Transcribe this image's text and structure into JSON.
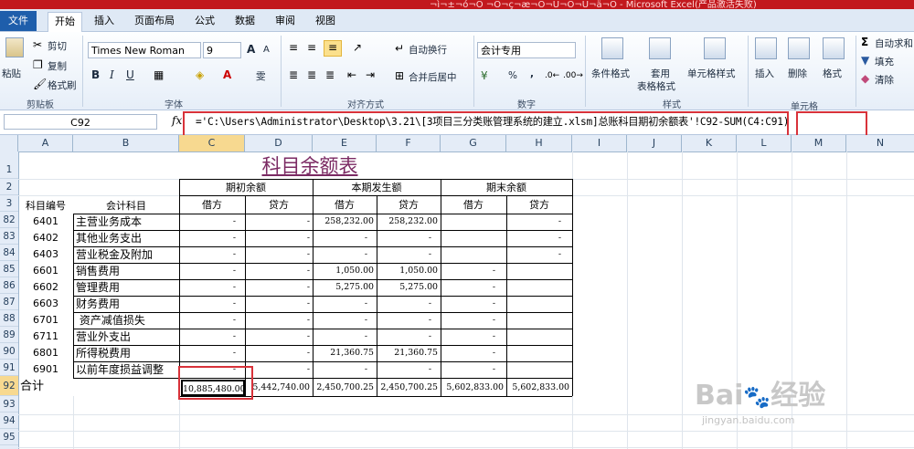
{
  "window": {
    "title": "¬ì¬±¬ó¬Ô ¬Ó¬ç¬æ¬Ö¬Ü¬Ö¬Ú¬ä¬Ö - Microsoft Excel(产品激活失败)"
  },
  "tabs": [
    "文件",
    "开始",
    "插入",
    "页面布局",
    "公式",
    "数据",
    "审阅",
    "视图"
  ],
  "ribbon": {
    "clipboard": {
      "paste": "粘贴",
      "cut": "剪切",
      "copy": "复制",
      "format_painter": "格式刷",
      "group": "剪贴板"
    },
    "font": {
      "name": "Times New Roman",
      "size": "9",
      "group": "字体",
      "bold": "B",
      "italic": "I",
      "underline": "U",
      "grow": "A",
      "shrink": "A",
      "wen": "雯"
    },
    "alignment": {
      "wrap": "自动换行",
      "merge": "合并后居中",
      "group": "对齐方式"
    },
    "number": {
      "format": "会计专用",
      "group": "数字",
      "percent": "%",
      "comma": ","
    },
    "styles": {
      "conditional": "条件格式",
      "table_1": "套用",
      "table_2": "表格格式",
      "cell_style": "单元格样式",
      "group": "样式"
    },
    "cells": {
      "insert": "插入",
      "delete": "删除",
      "format": "格式",
      "group": "单元格"
    },
    "editing": {
      "autosum": "自动求和",
      "fill": "填充",
      "clear": "清除"
    }
  },
  "formula_bar": {
    "name_box": "C92",
    "fx": "fx",
    "formula_part1": "='C:\\Users\\Administrator\\Desktop\\3.21\\[3项目三分类账管理系统的建立.xlsm]总账科目期初余额表'!C92",
    "formula_part2": "-SUM(C4:C91)"
  },
  "columns": [
    "A",
    "B",
    "C",
    "D",
    "E",
    "F",
    "G",
    "H",
    "I",
    "J",
    "K",
    "L",
    "M",
    "N"
  ],
  "row_labels": [
    "1",
    "2",
    "3",
    "82",
    "83",
    "84",
    "85",
    "86",
    "87",
    "88",
    "89",
    "90",
    "91",
    "92",
    "93",
    "94",
    "95"
  ],
  "sheet": {
    "title": "科目余额表",
    "header_code": "科目编号",
    "header_account": "会计科目",
    "group_opening": "期初余额",
    "group_current": "本期发生额",
    "group_closing": "期末余额",
    "debit": "借方",
    "credit": "贷方",
    "rows": [
      {
        "code": "6401",
        "name": "主营业务成本",
        "c": "-",
        "d": "-",
        "e": "258,232.00",
        "f": "258,232.00",
        "g": "",
        "h": "-"
      },
      {
        "code": "6402",
        "name": "其他业务支出",
        "c": "-",
        "d": "-",
        "e": "-",
        "f": "-",
        "g": "",
        "h": "-"
      },
      {
        "code": "6403",
        "name": "营业税金及附加",
        "c": "-",
        "d": "-",
        "e": "-",
        "f": "-",
        "g": "",
        "h": "-"
      },
      {
        "code": "6601",
        "name": "销售费用",
        "c": "-",
        "d": "-",
        "e": "1,050.00",
        "f": "1,050.00",
        "g": "-",
        "h": ""
      },
      {
        "code": "6602",
        "name": "管理费用",
        "c": "-",
        "d": "-",
        "e": "5,275.00",
        "f": "5,275.00",
        "g": "-",
        "h": ""
      },
      {
        "code": "6603",
        "name": "财务费用",
        "c": "-",
        "d": "-",
        "e": "-",
        "f": "-",
        "g": "-",
        "h": ""
      },
      {
        "code": "6701",
        "name": " 资产减值损失",
        "c": "-",
        "d": "-",
        "e": "-",
        "f": "-",
        "g": "-",
        "h": ""
      },
      {
        "code": "6711",
        "name": "营业外支出",
        "c": "-",
        "d": "-",
        "e": "-",
        "f": "-",
        "g": "-",
        "h": ""
      },
      {
        "code": "6801",
        "name": "所得税费用",
        "c": "-",
        "d": "-",
        "e": "21,360.75",
        "f": "21,360.75",
        "g": "-",
        "h": ""
      },
      {
        "code": "6901",
        "name": "以前年度损益调整",
        "c": "-",
        "d": "-",
        "e": "-",
        "f": "-",
        "g": "-",
        "h": ""
      }
    ],
    "total": {
      "label": "合计",
      "c": "10,885,480.00",
      "d": "5,442,740.00",
      "e": "2,450,700.25",
      "f": "2,450,700.25",
      "g": "5,602,833.00",
      "h": "5,602,833.00"
    }
  },
  "watermark": {
    "brand": "Bai",
    "logo": "经验",
    "url": "jingyan.baidu.com"
  }
}
